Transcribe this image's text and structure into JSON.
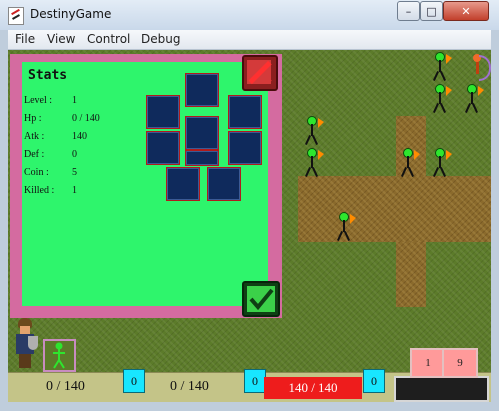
{
  "window": {
    "title": "DestinyGame"
  },
  "menu": [
    "File",
    "View",
    "Control",
    "Debug"
  ],
  "stats": {
    "title": "Stats",
    "rows": [
      {
        "label": "Level :",
        "value": "1"
      },
      {
        "label": "Hp :",
        "value": "0 / 140"
      },
      {
        "label": "Atk :",
        "value": "140"
      },
      {
        "label": "Def :",
        "value": "0"
      },
      {
        "label": "Coin :",
        "value": "5"
      },
      {
        "label": "Killed :",
        "value": "1"
      }
    ]
  },
  "hud": {
    "left_value": "0 / 140",
    "left_counter": "0",
    "mid_value": "0 / 140",
    "mid_counter": "0",
    "hp_bar": "140 / 140",
    "right_counter": "0",
    "page_buttons": [
      "1",
      "9"
    ]
  },
  "colors": {
    "grass": "#5c7b2a",
    "dirt": "#8a6a2c",
    "panel_frame": "#d46ba0",
    "panel_fill": "#2ef56c",
    "slot": "#0f2a5c",
    "hp_bar": "#ee1c1c",
    "counter": "#18e6ff"
  },
  "icons": {
    "close_button": "close-x-icon",
    "confirm_button": "checkmark-icon"
  }
}
